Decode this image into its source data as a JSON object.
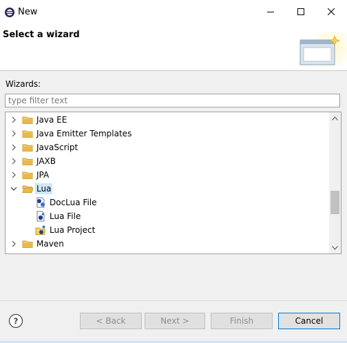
{
  "window": {
    "title": "New"
  },
  "header": {
    "title": "Select a wizard"
  },
  "wizards_label": "Wizards:",
  "filter": {
    "placeholder": "type filter text",
    "value": ""
  },
  "tree": {
    "items": [
      {
        "label": "Java EE",
        "icon": "folder-icon",
        "state": "collapsed"
      },
      {
        "label": "Java Emitter Templates",
        "icon": "folder-icon",
        "state": "collapsed"
      },
      {
        "label": "JavaScript",
        "icon": "folder-icon",
        "state": "collapsed"
      },
      {
        "label": "JAXB",
        "icon": "folder-icon",
        "state": "collapsed"
      },
      {
        "label": "JPA",
        "icon": "folder-icon",
        "state": "collapsed"
      },
      {
        "label": "Lua",
        "icon": "folder-icon",
        "state": "expanded",
        "selected": true
      },
      {
        "label": "DocLua File",
        "icon": "doclua-file-icon",
        "child": true
      },
      {
        "label": "Lua File",
        "icon": "lua-file-icon",
        "child": true
      },
      {
        "label": "Lua Project",
        "icon": "lua-project-icon",
        "child": true
      },
      {
        "label": "Maven",
        "icon": "folder-icon",
        "state": "collapsed"
      }
    ]
  },
  "buttons": {
    "back": "< Back",
    "next": "Next >",
    "finish": "Finish",
    "cancel": "Cancel"
  },
  "colors": {
    "selection": "#cce8ff",
    "accent": "#0078d7",
    "folder": "#e8b84a"
  }
}
